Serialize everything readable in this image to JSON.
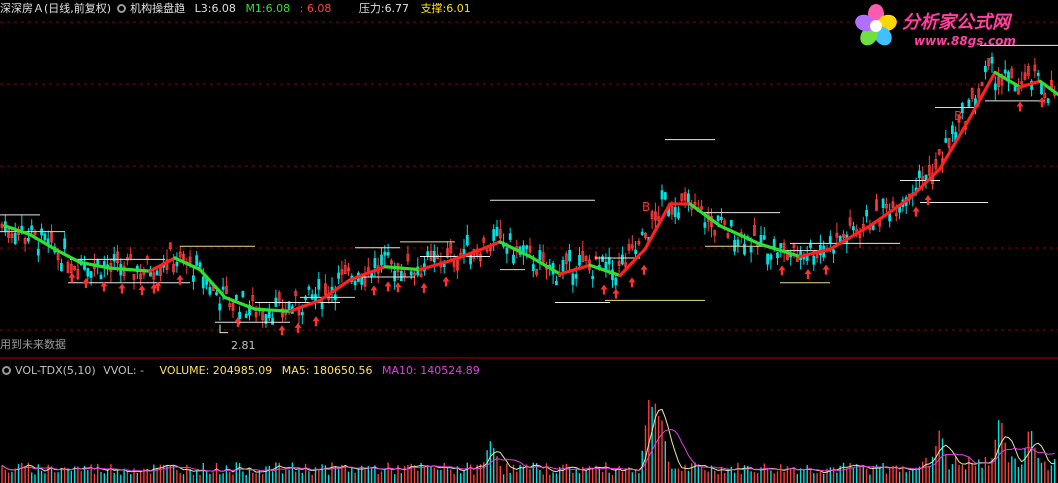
{
  "header": {
    "title": "深深房Ａ(日线,前复权)",
    "indicator_name": "机构操盘趋",
    "l3_label": "L3:",
    "l3_value": "6.08",
    "m1_label": "M1:",
    "m1_value": "6.08",
    "m1_extra": "6.08",
    "pressure_label": "压力:",
    "pressure_value": "6.77",
    "support_label": "支撑:",
    "support_value": "6.01"
  },
  "logo": {
    "name": "分析家公式网",
    "url": "www.88gs.com"
  },
  "notes": {
    "future_data": "用到未来数据",
    "low_price": "2.81"
  },
  "volume_header": {
    "indicator": "VOL-TDX(5,10)",
    "vvol": "VVOL: -",
    "volume_label": "VOLUME:",
    "volume_value": "204985.09",
    "ma5_label": "MA5:",
    "ma5_value": "180650.56",
    "ma10_label": "MA10:",
    "ma10_value": "140524.89"
  },
  "colors": {
    "up": "#ff3c3c",
    "down": "#00e0e0",
    "grid": "#8b0000",
    "trend_up": "#ff2020",
    "trend_down": "#30e030",
    "level_line": "#e8e8e8",
    "support_line": "#e8e090",
    "ma5": "#e8e8a0",
    "ma10": "#e040e0",
    "buy_marker": "#ff3030"
  },
  "chart_data": [
    {
      "type": "candlestick",
      "title": "深深房Ａ(日线,前复权)",
      "y_scale": "price",
      "ylim": [
        2.6,
        7.2
      ],
      "grid": true,
      "trend_line_anchors": [
        {
          "x": 5,
          "y": 4.3
        },
        {
          "x": 30,
          "y": 4.18
        },
        {
          "x": 55,
          "y": 3.98
        },
        {
          "x": 80,
          "y": 3.8
        },
        {
          "x": 110,
          "y": 3.72
        },
        {
          "x": 150,
          "y": 3.68
        },
        {
          "x": 175,
          "y": 3.86
        },
        {
          "x": 200,
          "y": 3.7
        },
        {
          "x": 225,
          "y": 3.32
        },
        {
          "x": 255,
          "y": 3.16
        },
        {
          "x": 290,
          "y": 3.13
        },
        {
          "x": 320,
          "y": 3.28
        },
        {
          "x": 350,
          "y": 3.56
        },
        {
          "x": 385,
          "y": 3.74
        },
        {
          "x": 420,
          "y": 3.7
        },
        {
          "x": 450,
          "y": 3.82
        },
        {
          "x": 480,
          "y": 3.97
        },
        {
          "x": 500,
          "y": 4.08
        },
        {
          "x": 530,
          "y": 3.88
        },
        {
          "x": 560,
          "y": 3.64
        },
        {
          "x": 590,
          "y": 3.76
        },
        {
          "x": 620,
          "y": 3.62
        },
        {
          "x": 645,
          "y": 3.98
        },
        {
          "x": 670,
          "y": 4.6
        },
        {
          "x": 690,
          "y": 4.6
        },
        {
          "x": 720,
          "y": 4.3
        },
        {
          "x": 760,
          "y": 4.05
        },
        {
          "x": 800,
          "y": 3.88
        },
        {
          "x": 830,
          "y": 3.98
        },
        {
          "x": 870,
          "y": 4.3
        },
        {
          "x": 910,
          "y": 4.68
        },
        {
          "x": 940,
          "y": 5.08
        },
        {
          "x": 970,
          "y": 5.78
        },
        {
          "x": 995,
          "y": 6.4
        },
        {
          "x": 1020,
          "y": 6.2
        },
        {
          "x": 1040,
          "y": 6.28
        },
        {
          "x": 1058,
          "y": 6.1
        }
      ],
      "level_lines": [
        {
          "x1": 0,
          "x2": 40,
          "y": 4.45
        },
        {
          "x1": 0,
          "x2": 65,
          "y": 4.22
        },
        {
          "x1": 70,
          "x2": 165,
          "y": 3.84
        },
        {
          "x1": 68,
          "x2": 190,
          "y": 3.52
        },
        {
          "x1": 180,
          "x2": 255,
          "y": 4.02
        },
        {
          "x1": 215,
          "x2": 290,
          "y": 2.98
        },
        {
          "x1": 255,
          "x2": 340,
          "y": 3.25
        },
        {
          "x1": 300,
          "x2": 355,
          "y": 3.32
        },
        {
          "x1": 355,
          "x2": 400,
          "y": 4.0
        },
        {
          "x1": 360,
          "x2": 415,
          "y": 3.6
        },
        {
          "x1": 400,
          "x2": 455,
          "y": 4.08
        },
        {
          "x1": 420,
          "x2": 490,
          "y": 3.88
        },
        {
          "x1": 490,
          "x2": 595,
          "y": 4.65
        },
        {
          "x1": 500,
          "x2": 525,
          "y": 3.7
        },
        {
          "x1": 555,
          "x2": 610,
          "y": 3.25
        },
        {
          "x1": 595,
          "x2": 640,
          "y": 3.86
        },
        {
          "x1": 605,
          "x2": 705,
          "y": 3.28
        },
        {
          "x1": 665,
          "x2": 715,
          "y": 5.48
        },
        {
          "x1": 700,
          "x2": 780,
          "y": 4.48
        },
        {
          "x1": 705,
          "x2": 770,
          "y": 4.02
        },
        {
          "x1": 780,
          "x2": 830,
          "y": 3.96
        },
        {
          "x1": 790,
          "x2": 900,
          "y": 4.06
        },
        {
          "x1": 780,
          "x2": 830,
          "y": 3.52
        },
        {
          "x1": 900,
          "x2": 940,
          "y": 4.92
        },
        {
          "x1": 920,
          "x2": 988,
          "y": 4.62
        },
        {
          "x1": 935,
          "x2": 975,
          "y": 5.92
        },
        {
          "x1": 980,
          "x2": 1058,
          "y": 6.77
        },
        {
          "x1": 985,
          "x2": 1045,
          "y": 6.01
        }
      ],
      "buy_markers_x": [
        72,
        86,
        104,
        122,
        142,
        154,
        158,
        180,
        238,
        282,
        298,
        316,
        374,
        388,
        398,
        424,
        446,
        604,
        616,
        632,
        644,
        782,
        808,
        826,
        916,
        928,
        1020,
        1042
      ],
      "b_labels": [
        {
          "x": 646,
          "y": 4.5
        },
        {
          "x": 958,
          "y": 5.75
        }
      ],
      "low_annotation": {
        "x": 228,
        "y": 2.81,
        "label": "2.81"
      }
    },
    {
      "type": "bar",
      "title": "VOL-TDX(5,10)",
      "series": [
        {
          "name": "VOLUME",
          "last_value": 204985.09
        },
        {
          "name": "MA5",
          "last_value": 180650.56
        },
        {
          "name": "MA10",
          "last_value": 140524.89
        }
      ],
      "spikes": [
        {
          "x": 490,
          "value": 75000
        },
        {
          "x": 494,
          "value": 62000
        },
        {
          "x": 650,
          "value": 160000
        },
        {
          "x": 656,
          "value": 145000
        },
        {
          "x": 660,
          "value": 130000
        },
        {
          "x": 940,
          "value": 75000
        },
        {
          "x": 1000,
          "value": 95000
        },
        {
          "x": 1030,
          "value": 80000
        }
      ],
      "ylim": [
        0,
        170000
      ]
    }
  ]
}
